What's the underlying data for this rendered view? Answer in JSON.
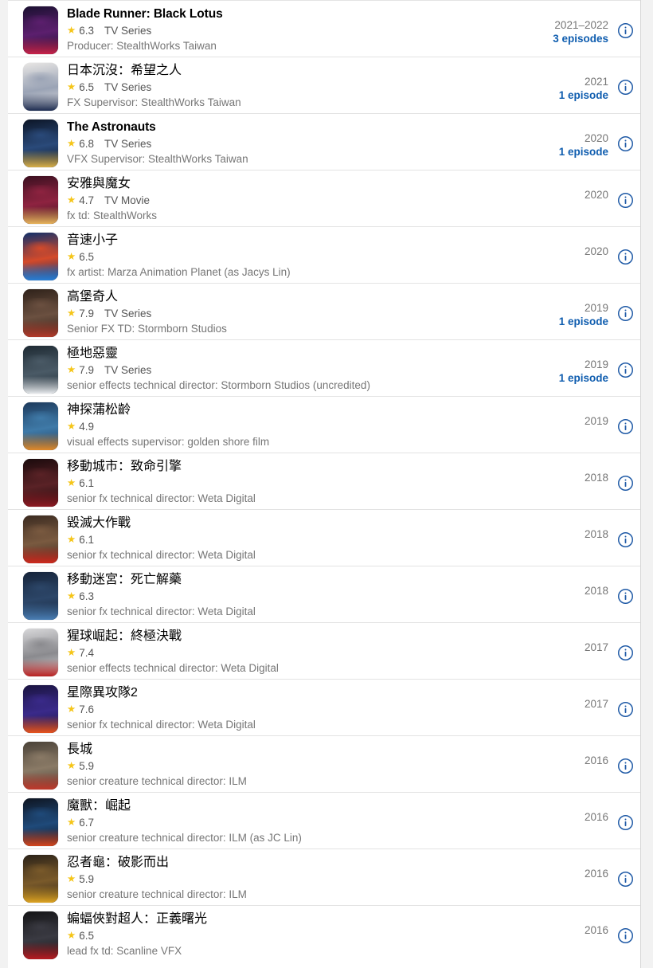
{
  "icons": {
    "star": "star-icon",
    "info": "info-circle-icon"
  },
  "colors": {
    "star": "#f5c518",
    "episode_link": "#0f5daf",
    "info_icon": "#1f5aa6",
    "page_bg": "#f2f2f2",
    "card_bg": "#ffffff",
    "divider": "#e3e3e3"
  },
  "credits": [
    {
      "title": "Blade Runner: Black Lotus",
      "script": "latin",
      "rating": "6.3",
      "kind": "TV Series",
      "role": "Producer: StealthWorks Taiwan",
      "year": "2021–2022",
      "episodes": "3 episodes",
      "poster": {
        "base": "#1a1030",
        "accent": "#c9234a",
        "glow": "#5c1f6e"
      }
    },
    {
      "title": "日本沉沒：希望之人",
      "script": "cjk",
      "rating": "6.5",
      "kind": "TV Series",
      "role": "FX Supervisor: StealthWorks Taiwan",
      "year": "2021",
      "episodes": "1 episode",
      "poster": {
        "base": "#e8e6e4",
        "accent": "#1c2b50",
        "glow": "#9aa3b5"
      }
    },
    {
      "title": "The Astronauts",
      "script": "latin",
      "rating": "6.8",
      "kind": "TV Series",
      "role": "VFX Supervisor: StealthWorks Taiwan",
      "year": "2020",
      "episodes": "1 episode",
      "poster": {
        "base": "#0c1526",
        "accent": "#d8b04a",
        "glow": "#2a4a7a"
      }
    },
    {
      "title": "安雅與魔女",
      "script": "cjk",
      "rating": "4.7",
      "kind": "TV Movie",
      "role": "fx td: StealthWorks",
      "year": "2020",
      "episodes": "",
      "poster": {
        "base": "#3b1020",
        "accent": "#e8b45c",
        "glow": "#8e2340"
      }
    },
    {
      "title": "音速小子",
      "script": "cjk",
      "rating": "6.5",
      "kind": "",
      "role": "fx artist: Marza Animation Planet (as Jacys Lin)",
      "year": "2020",
      "episodes": "",
      "poster": {
        "base": "#10306b",
        "accent": "#2a7fd4",
        "glow": "#d44a2a"
      }
    },
    {
      "title": "高堡奇人",
      "script": "cjk",
      "rating": "7.9",
      "kind": "TV Series",
      "role": "Senior FX TD: Stormborn Studios",
      "year": "2019",
      "episodes": "1 episode",
      "poster": {
        "base": "#2e2119",
        "accent": "#b33a2a",
        "glow": "#6b5040"
      }
    },
    {
      "title": "極地惡靈",
      "script": "cjk",
      "rating": "7.9",
      "kind": "TV Series",
      "role": "senior effects technical director: Stormborn Studios (uncredited)",
      "year": "2019",
      "episodes": "1 episode",
      "poster": {
        "base": "#1e2a33",
        "accent": "#e6e9ec",
        "glow": "#4a5a66"
      }
    },
    {
      "title": "神探蒲松齡",
      "script": "cjk",
      "rating": "4.9",
      "kind": "",
      "role": "visual effects supervisor: golden shore film",
      "year": "2019",
      "episodes": "",
      "poster": {
        "base": "#1d3a5c",
        "accent": "#e08a2a",
        "glow": "#3f7aa8"
      }
    },
    {
      "title": "移動城市：致命引擎",
      "script": "cjk",
      "rating": "6.1",
      "kind": "",
      "role": "senior fx technical director: Weta Digital",
      "year": "2018",
      "episodes": "",
      "poster": {
        "base": "#1a0a0c",
        "accent": "#8e1a22",
        "glow": "#5a2226"
      }
    },
    {
      "title": "毀滅大作戰",
      "script": "cjk",
      "rating": "6.1",
      "kind": "",
      "role": "senior fx technical director: Weta Digital",
      "year": "2018",
      "episodes": "",
      "poster": {
        "base": "#3a2a20",
        "accent": "#cf2a1e",
        "glow": "#7a5a40"
      }
    },
    {
      "title": "移動迷宮：死亡解藥",
      "script": "cjk",
      "rating": "6.3",
      "kind": "",
      "role": "senior fx technical director: Weta Digital",
      "year": "2018",
      "episodes": "",
      "poster": {
        "base": "#16243a",
        "accent": "#4a7fb5",
        "glow": "#2c4668"
      }
    },
    {
      "title": "猩球崛起：終極決戰",
      "script": "cjk",
      "rating": "7.4",
      "kind": "",
      "role": "senior effects technical director: Weta Digital",
      "year": "2017",
      "episodes": "",
      "poster": {
        "base": "#d8d8da",
        "accent": "#b82020",
        "glow": "#8a8a8e"
      }
    },
    {
      "title": "星際異攻隊2",
      "script": "cjk",
      "rating": "7.6",
      "kind": "",
      "role": "senior fx technical director: Weta Digital",
      "year": "2017",
      "episodes": "",
      "poster": {
        "base": "#1a1440",
        "accent": "#e8541e",
        "glow": "#3a2a8a"
      }
    },
    {
      "title": "長城",
      "script": "cjk",
      "rating": "5.9",
      "kind": "",
      "role": "senior creature technical director: ILM",
      "year": "2016",
      "episodes": "",
      "poster": {
        "base": "#4a4238",
        "accent": "#c0392b",
        "glow": "#8a7a66"
      }
    },
    {
      "title": "魔獸：崛起",
      "script": "cjk",
      "rating": "6.7",
      "kind": "",
      "role": "senior creature technical director: ILM (as JC Lin)",
      "year": "2016",
      "episodes": "",
      "poster": {
        "base": "#0e1420",
        "accent": "#d4461e",
        "glow": "#1f4a7a"
      }
    },
    {
      "title": "忍者龜：破影而出",
      "script": "cjk",
      "rating": "5.9",
      "kind": "",
      "role": "senior creature technical director: ILM",
      "year": "2016",
      "episodes": "",
      "poster": {
        "base": "#2a2118",
        "accent": "#e0a522",
        "glow": "#7a5a2a"
      }
    },
    {
      "title": "蝙蝠俠對超人：正義曙光",
      "script": "cjk",
      "rating": "6.5",
      "kind": "",
      "role": "lead fx td: Scanline VFX",
      "year": "2016",
      "episodes": "",
      "poster": {
        "base": "#141416",
        "accent": "#b81c22",
        "glow": "#3a3a42"
      }
    }
  ]
}
